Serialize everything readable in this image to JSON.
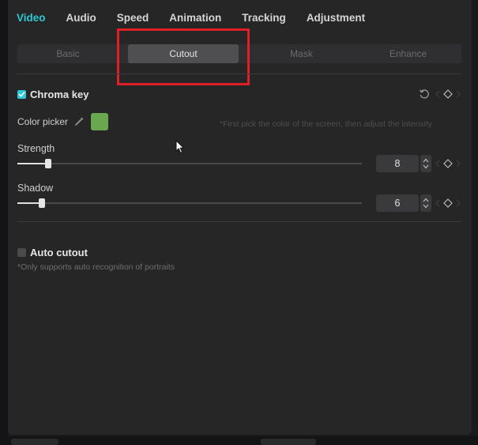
{
  "tabs": [
    {
      "label": "Video",
      "active": true
    },
    {
      "label": "Audio",
      "active": false
    },
    {
      "label": "Speed",
      "active": false
    },
    {
      "label": "Animation",
      "active": false
    },
    {
      "label": "Tracking",
      "active": false
    },
    {
      "label": "Adjustment",
      "active": false
    }
  ],
  "subtabs": [
    {
      "label": "Basic",
      "active": false
    },
    {
      "label": "Cutout",
      "active": true
    },
    {
      "label": "Mask",
      "active": false
    },
    {
      "label": "Enhance",
      "active": false
    }
  ],
  "chroma_key": {
    "title": "Chroma key",
    "checked": true,
    "color_picker_label": "Color picker",
    "picked_color": "#6aa84f",
    "hint": "*First pick the color of the screen, then adjust the intensity",
    "strength": {
      "label": "Strength",
      "value": "8",
      "fraction": 0.09
    },
    "shadow": {
      "label": "Shadow",
      "value": "6",
      "fraction": 0.07
    }
  },
  "auto_cutout": {
    "title": "Auto cutout",
    "checked": false,
    "hint": "*Only supports auto recognition of portraits"
  },
  "colors": {
    "accent": "#2cc8d6",
    "highlight_box": "#e01e26"
  },
  "icons": {
    "reset": "reset-icon",
    "keyframe": "keyframe-diamond-icon",
    "eyedropper": "eyedropper-icon"
  }
}
